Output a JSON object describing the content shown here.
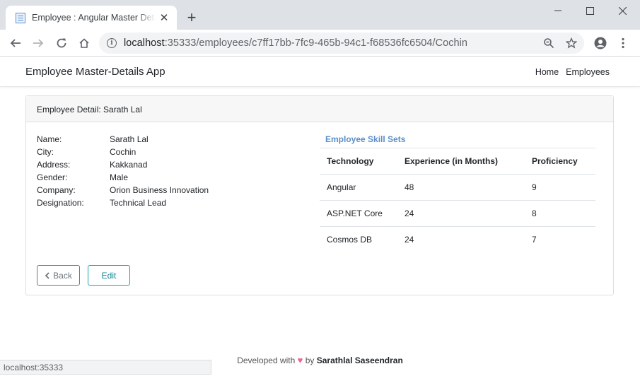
{
  "browser": {
    "tab_title": "Employee : Angular Master Details",
    "tab_close": "✕",
    "new_tab": "+",
    "url_host": "localhost",
    "url_rest": ":35333/employees/c7ff17bb-7fc9-465b-94c1-f68536fc6504/Cochin",
    "status_text": "localhost:35333"
  },
  "app": {
    "brand": "Employee Master-Details App",
    "nav": {
      "home": "Home",
      "employees": "Employees"
    }
  },
  "card": {
    "header": "Employee Detail: Sarath Lal",
    "details": [
      {
        "label": "Name:",
        "value": "Sarath Lal"
      },
      {
        "label": "City:",
        "value": "Cochin"
      },
      {
        "label": "Address:",
        "value": "Kakkanad"
      },
      {
        "label": "Gender:",
        "value": "Male"
      },
      {
        "label": "Company:",
        "value": "Orion Business Innovation"
      },
      {
        "label": "Designation:",
        "value": "Technical Lead"
      }
    ],
    "skills_title": "Employee Skill Sets",
    "skills_headers": [
      "Technology",
      "Experience (in Months)",
      "Proficiency"
    ],
    "skills": [
      [
        "Angular",
        "48",
        "9"
      ],
      [
        "ASP.NET Core",
        "24",
        "8"
      ],
      [
        "Cosmos DB",
        "24",
        "7"
      ]
    ],
    "back_label": "Back",
    "edit_label": "Edit"
  },
  "footer": {
    "prefix": "Developed with",
    "heart": "♥",
    "by": "by",
    "author": "Sarathlal Saseendran"
  },
  "colors": {
    "tab_strip": "#dee1e6",
    "accent_skill_title": "#5b8fc9",
    "edit_button": "#17a2b8",
    "heart": "#f06292"
  }
}
